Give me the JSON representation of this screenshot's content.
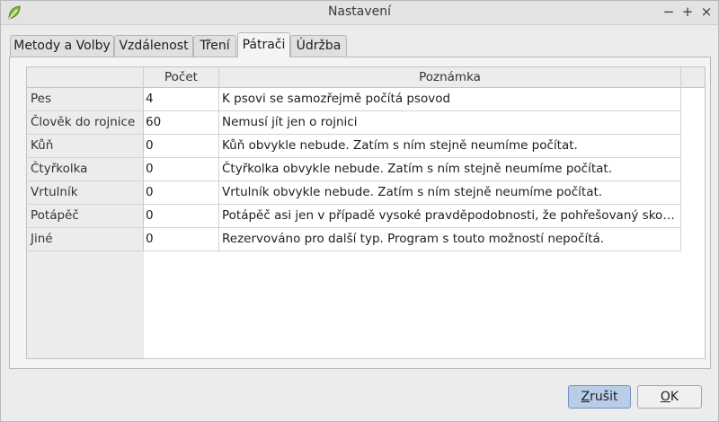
{
  "window": {
    "title": "Nastavení",
    "controls": {
      "close": "×",
      "minimize": "−",
      "maximize": "+"
    }
  },
  "tabs": [
    {
      "label": "Metody a Volby",
      "active": false
    },
    {
      "label": "Vzdálenost",
      "active": false
    },
    {
      "label": "Tření",
      "active": false
    },
    {
      "label": "Pátrači",
      "active": true
    },
    {
      "label": "Údržba",
      "active": false
    }
  ],
  "table": {
    "columns": [
      "Počet",
      "Poznámka"
    ],
    "rows": [
      {
        "label": "Pes",
        "count": "4",
        "note": "K psovi se samozřejmě počítá psovod"
      },
      {
        "label": "Člověk do rojnice",
        "count": "60",
        "note": "Nemusí jít jen o rojnici"
      },
      {
        "label": "Kůň",
        "count": "0",
        "note": "Kůň obvykle nebude. Zatím s ním stejně neumíme počítat."
      },
      {
        "label": "Čtyřkolka",
        "count": "0",
        "note": "Čtyřkolka obvykle nebude. Zatím s ním stejně neumíme počítat."
      },
      {
        "label": "Vrtulník",
        "count": "0",
        "note": "Vrtulník obvykle nebude. Zatím s ním stejně neumíme počítat."
      },
      {
        "label": "Potápěč",
        "count": "0",
        "note": "Potápěč asi jen v případě vysoké pravděpodobnosti, že pohřešovaný skon…"
      },
      {
        "label": "Jiné",
        "count": "0",
        "note": "Rezervováno pro další typ. Program s touto možností nepočítá."
      }
    ]
  },
  "buttons": {
    "cancel_first": "Z",
    "cancel_rest": "rušit",
    "ok_first": "O",
    "ok_rest": "K"
  },
  "colors": {
    "default_button": "#b9cde6",
    "app_icon": "#7aa93a"
  }
}
